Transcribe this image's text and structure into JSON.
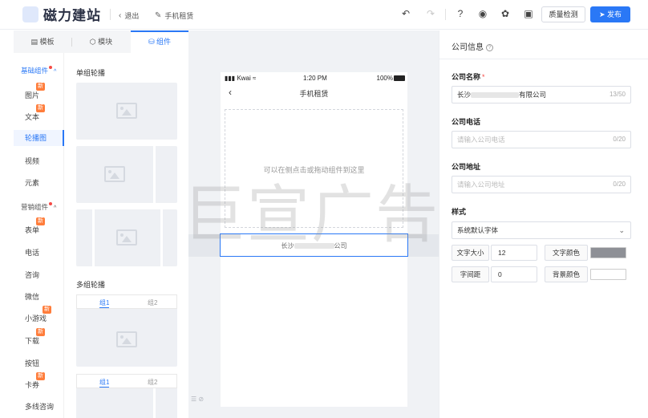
{
  "app": {
    "title": "磁力建站"
  },
  "header": {
    "back_label": "退出",
    "page_name": "手机租赁",
    "quality_check_label": "质量检测",
    "publish_label": "发布"
  },
  "left_tabs": [
    "模板",
    "模块",
    "组件"
  ],
  "categories": {
    "basic_group": "基础组件",
    "basic_items": [
      "图片",
      "文本",
      "轮播图",
      "视频",
      "元素"
    ],
    "marketing_group": "营销组件",
    "marketing_items": [
      "表单",
      "电话",
      "咨询",
      "微信",
      "小游戏",
      "下载",
      "按钮",
      "卡券",
      "多线咨询"
    ],
    "new_badge": "新"
  },
  "components": {
    "single_carousel_title": "单组轮播",
    "multi_carousel_title": "多组轮播",
    "group_tab_1": "组1",
    "group_tab_2": "组2"
  },
  "canvas": {
    "status_carrier": "Kwai",
    "status_time": "1:20 PM",
    "status_battery": "100%",
    "nav_title": "手机租赁",
    "drop_hint": "可以在侧点击或拖动组件到这里",
    "selected_prefix": "长沙",
    "selected_suffix": "公司"
  },
  "watermark": "巨宣广告",
  "right_panel": {
    "title": "公司信息",
    "name_label": "公司名称",
    "name_value_prefix": "长沙",
    "name_value_suffix": "有限公司",
    "name_count": "13/50",
    "phone_label": "公司电话",
    "phone_placeholder": "请输入公司电话",
    "phone_count": "0/20",
    "address_label": "公司地址",
    "address_placeholder": "请输入公司地址",
    "address_count": "0/20",
    "style_label": "样式",
    "font_value": "系统默认字体",
    "font_size_label": "文字大小",
    "font_size_value": "12",
    "text_color_label": "文字颜色",
    "text_color": "#8e9096",
    "letter_spacing_label": "字间距",
    "letter_spacing_value": "0",
    "bg_color_label": "背景颜色",
    "bg_color": "#ffffff"
  },
  "colors": {
    "accent": "#2a78f6",
    "badge": "#ff7d3b"
  }
}
